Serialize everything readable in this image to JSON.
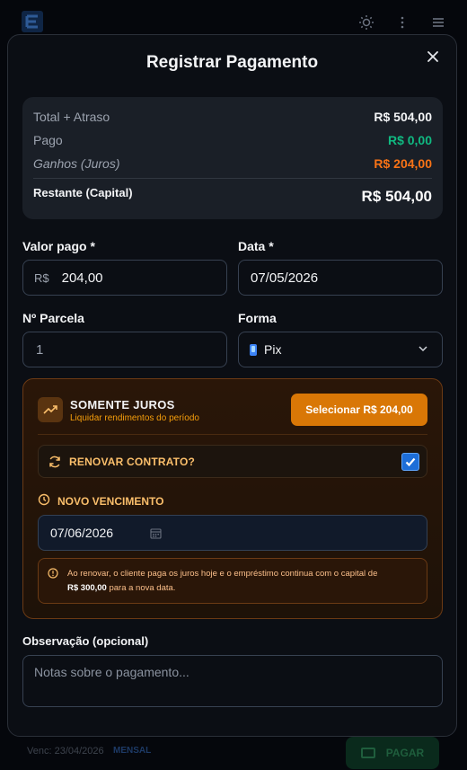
{
  "background": {
    "venc_text": "Venc: 23/04/2026",
    "badge": "MENSAL",
    "pay_button": "PAGAR"
  },
  "modal": {
    "title": "Registrar Pagamento",
    "summary": {
      "total_label": "Total + Atraso",
      "total_value": "R$ 504,00",
      "pago_label": "Pago",
      "pago_value": "R$ 0,00",
      "ganhos_label": "Ganhos (Juros)",
      "ganhos_value": "R$ 204,00",
      "restante_label": "Restante (Capital)",
      "restante_value": "R$ 504,00"
    },
    "valor_pago": {
      "label": "Valor pago *",
      "prefix": "R$",
      "value": "204,00"
    },
    "data": {
      "label": "Data *",
      "value": "07/05/2026"
    },
    "parcela": {
      "label": "Nº Parcela",
      "value": "1"
    },
    "forma": {
      "label": "Forma",
      "value": "Pix"
    },
    "somente_juros": {
      "title": "SOMENTE JUROS",
      "subtitle": "Liquidar rendimentos do período",
      "select_button": "Selecionar R$ 204,00",
      "renovar_label": "RENOVAR CONTRATO?",
      "renovar_checked": true,
      "novo_vencimento_label": "NOVO VENCIMENTO",
      "novo_vencimento_value": "07/06/2026",
      "info_text_1": "Ao renovar, o cliente paga os juros hoje e o empréstimo continua com o capital de",
      "info_amount": "R$ 300,00",
      "info_text_2": "para a nova data."
    },
    "observacao": {
      "label": "Observação (opcional)",
      "placeholder": "Notas sobre o pagamento..."
    }
  },
  "colors": {
    "accent_orange": "#d97706",
    "green": "#10b981",
    "orange_text": "#f97316",
    "checkbox_blue": "#1d6ed8"
  }
}
